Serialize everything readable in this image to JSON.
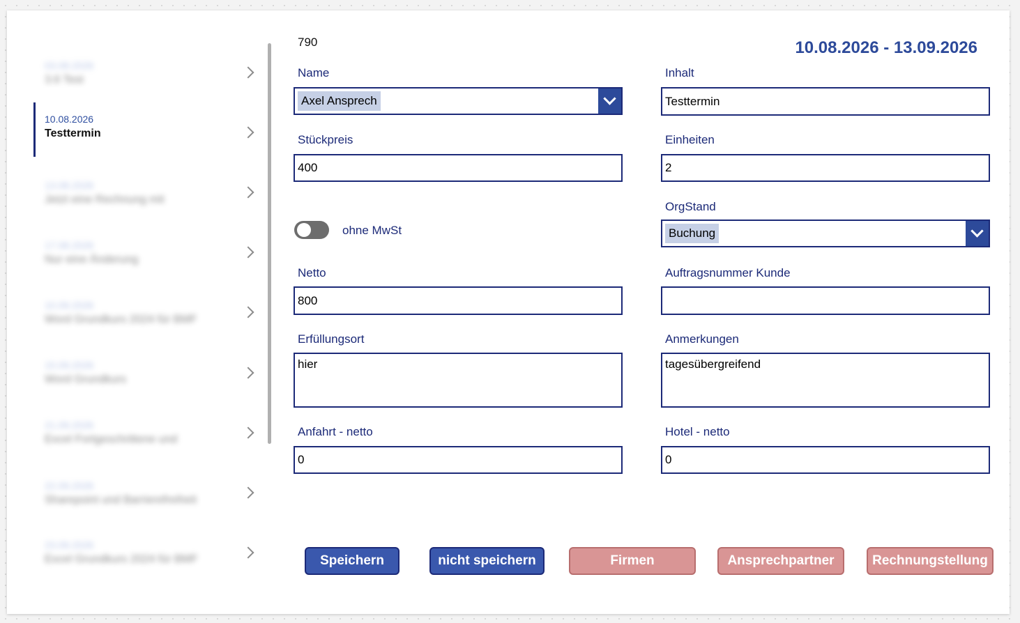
{
  "list": {
    "items": [
      {
        "date": "03.08.2026",
        "title": "3.6 Test",
        "blurred": true
      },
      {
        "date": "10.08.2026",
        "title": "Testtermin",
        "blurred": false,
        "selected": true
      },
      {
        "date": "13.08.2026",
        "title": "Jetzt eine Rechnung mit",
        "blurred": true
      },
      {
        "date": "17.08.2026",
        "title": "Nur eine Änderung",
        "blurred": true
      },
      {
        "date": "10.09.2026",
        "title": "Word Grundkurs 2024 für BMF",
        "blurred": true
      },
      {
        "date": "15.09.2026",
        "title": "Word Grundkurs",
        "blurred": true
      },
      {
        "date": "21.09.2026",
        "title": "Excel Fortgeschrittene und",
        "blurred": true
      },
      {
        "date": "22.09.2026",
        "title": "Sharepoint und Barrierefreiheit",
        "blurred": true
      },
      {
        "date": "23.09.2026",
        "title": "Excel Grundkurs 2024 für BMF",
        "blurred": true
      }
    ]
  },
  "form": {
    "id": "790",
    "date_range": "10.08.2026 - 13.09.2026",
    "name_label": "Name",
    "name_value": "Axel Ansprech",
    "inhalt_label": "Inhalt",
    "inhalt_value": "Testtermin",
    "stueckpreis_label": "Stückpreis",
    "stueckpreis_value": "400",
    "einheiten_label": "Einheiten",
    "einheiten_value": "2",
    "ohne_mwst_label": "ohne MwSt",
    "ohne_mwst_on": false,
    "orgstand_label": "OrgStand",
    "orgstand_value": "Buchung",
    "netto_label": "Netto",
    "netto_value": "800",
    "auftragsnummer_label": "Auftragsnummer Kunde",
    "auftragsnummer_value": "",
    "erfuellungsort_label": "Erfüllungsort",
    "erfuellungsort_value": "hier",
    "anmerkungen_label": "Anmerkungen",
    "anmerkungen_value": "tagesübergreifend",
    "anfahrt_label": "Anfahrt - netto",
    "anfahrt_value": "0",
    "hotel_label": "Hotel - netto",
    "hotel_value": "0"
  },
  "buttons": {
    "save": "Speichern",
    "dont_save": "nicht speichern",
    "firmen": "Firmen",
    "ansprechpartner": "Ansprechpartner",
    "rechnungstellung": "Rechnungstellung"
  },
  "colors": {
    "accent": "#2d4a9a",
    "border": "#1c2a78",
    "action_blue": "#3a58ad",
    "action_pink": "#d99595"
  },
  "icons": {
    "list_chevron": "chevron-right-icon",
    "dropdown_chevron": "chevron-down-icon"
  }
}
